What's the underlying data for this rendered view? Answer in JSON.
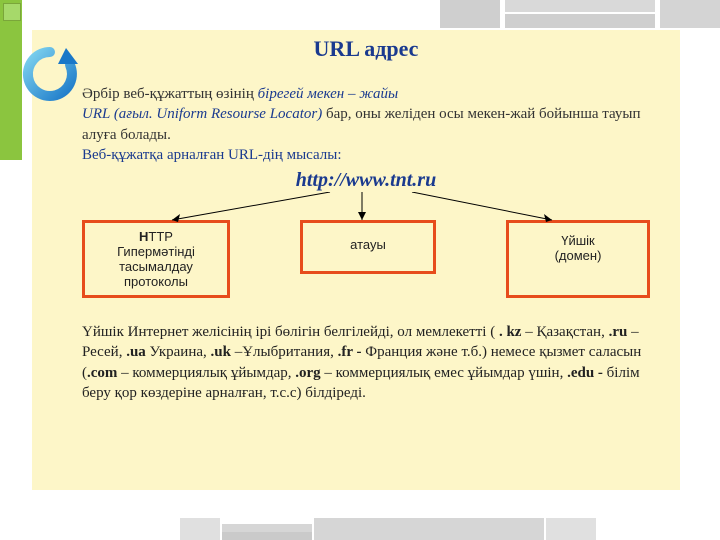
{
  "title": "URL адрес",
  "p1": {
    "a": "Әрбір веб-құжаттың өзінің ",
    "b": "бірегей мекен – жайы",
    "c": "URL (ағыл. Uniform Resourse Locator) ",
    "d": "бар",
    "e": ", оны желіден осы мекен-жай бойынша тауып алуға болады.",
    "f": "Веб-құжатқа  арналған URL-дің   мысалы:"
  },
  "url": "http://www.tnt.ru",
  "boxes": {
    "b1_l1": "Н",
    "b1_l2": "ТТР",
    "b1_l3": "Гипермәтінді",
    "b1_l4": "тасымалдау",
    "b1_l5": "протоколы",
    "b2": "атауы",
    "b3_l1": "Үйшік",
    "b3_l2": "(домен)"
  },
  "p2": {
    "a": "Үйшік Интернет желісінің ірі бөлігін белгілейді, ол мемлекетті ( ",
    "kz": ". kz",
    "kz_t": " – Қазақстан, ",
    "ru": ".ru",
    "ru_t": " – Ресей,  ",
    "ua": ".ua",
    "ua_t": " Украина,  ",
    "uk": ".uk",
    "uk_t": " –Ұлыбритания,  ",
    "fr": ".fr - ",
    "fr_t": "Франция және т.б.) немесе қызмет саласын (",
    "com": ".com",
    "com_t": " – коммерциялық ұйымдар,  ",
    "org": ".org",
    "org_t": " – коммерциялық емес ұйымдар үшін,  ",
    "edu": ".edu - ",
    "edu_t": " білім беру қор көздеріне арналған, т.с.с) білдіреді",
    "dot": "."
  },
  "icon_name": "refresh-arrow-icon"
}
